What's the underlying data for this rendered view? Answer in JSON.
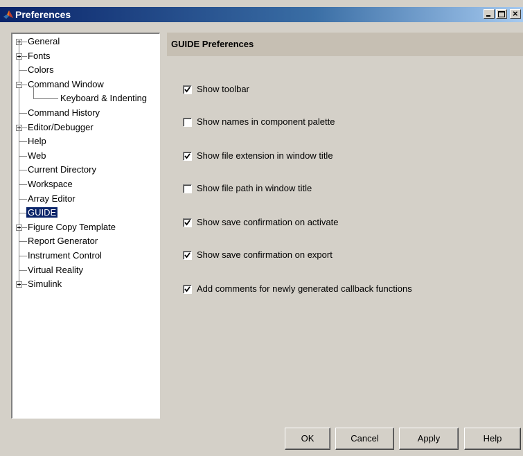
{
  "window": {
    "title": "Preferences",
    "buttons": {
      "minimize": "minimize",
      "maximize": "maximize",
      "close": "×"
    }
  },
  "tree": {
    "items": [
      {
        "label": "General",
        "expander": "plus",
        "level": 0
      },
      {
        "label": "Fonts",
        "expander": "plus",
        "level": 0
      },
      {
        "label": "Colors",
        "expander": "none",
        "level": 0
      },
      {
        "label": "Command Window",
        "expander": "minus",
        "level": 0
      },
      {
        "label": "Keyboard & Indenting",
        "expander": "none",
        "level": 1
      },
      {
        "label": "Command History",
        "expander": "none",
        "level": 0
      },
      {
        "label": "Editor/Debugger",
        "expander": "plus",
        "level": 0
      },
      {
        "label": "Help",
        "expander": "none",
        "level": 0
      },
      {
        "label": "Web",
        "expander": "none",
        "level": 0
      },
      {
        "label": "Current Directory",
        "expander": "none",
        "level": 0
      },
      {
        "label": "Workspace",
        "expander": "none",
        "level": 0
      },
      {
        "label": "Array Editor",
        "expander": "none",
        "level": 0
      },
      {
        "label": "GUIDE",
        "expander": "none",
        "level": 0,
        "selected": true
      },
      {
        "label": "Figure Copy Template",
        "expander": "plus",
        "level": 0
      },
      {
        "label": "Report Generator",
        "expander": "none",
        "level": 0
      },
      {
        "label": "Instrument Control",
        "expander": "none",
        "level": 0
      },
      {
        "label": "Virtual Reality",
        "expander": "none",
        "level": 0
      },
      {
        "label": "Simulink",
        "expander": "plus",
        "level": 0
      }
    ]
  },
  "panel": {
    "title": "GUIDE Preferences",
    "options": [
      {
        "label": "Show toolbar",
        "checked": true
      },
      {
        "label": "Show names in component palette",
        "checked": false
      },
      {
        "label": "Show file extension in window title",
        "checked": true
      },
      {
        "label": "Show file path in window title",
        "checked": false
      },
      {
        "label": "Show save confirmation on activate",
        "checked": true
      },
      {
        "label": "Show save confirmation on export",
        "checked": true
      },
      {
        "label": "Add comments for newly generated callback functions",
        "checked": true
      }
    ]
  },
  "buttons": {
    "ok": "OK",
    "cancel": "Cancel",
    "apply": "Apply",
    "help": "Help"
  },
  "colors": {
    "titlebar_start": "#0a246a",
    "selection": "#0a246a",
    "panel_header": "#c6bfb3",
    "window_bg": "#d4d0c8"
  }
}
